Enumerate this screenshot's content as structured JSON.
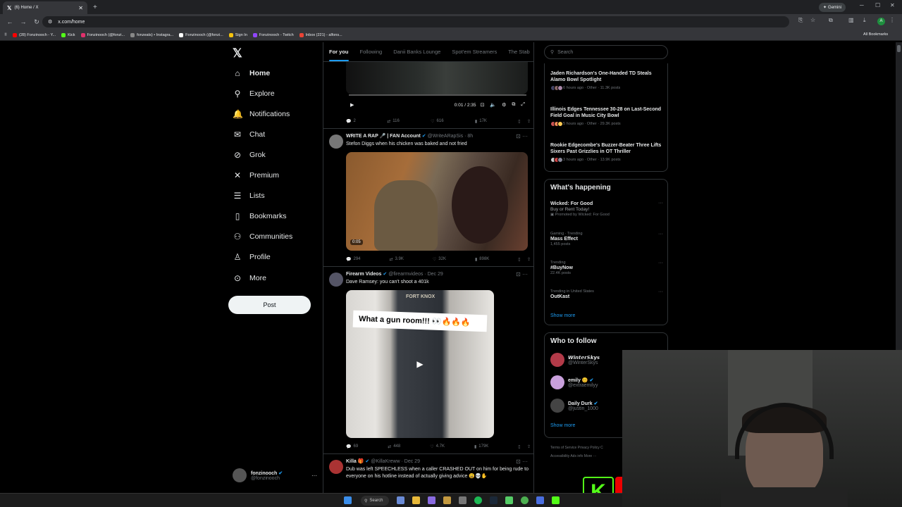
{
  "browser": {
    "tab_title": "(6) Home / X",
    "url": "x.com/home",
    "gemini_label": "Gemini",
    "bookmarks": [
      {
        "label": "(28) Fonzinooch - Y...",
        "color": "#ff0000"
      },
      {
        "label": "Kick",
        "color": "#53fc18"
      },
      {
        "label": "Fonzinooch (@fonzi...",
        "color": "#e1306c"
      },
      {
        "label": "fonzeats) • Instagra...",
        "color": "#888888"
      },
      {
        "label": "Fonzinooch (@fonzi...",
        "color": "#ffffff"
      },
      {
        "label": "Sign In",
        "color": "#f4c20d"
      },
      {
        "label": "Fonzinooch - Twitch",
        "color": "#9146ff"
      },
      {
        "label": "Inbox (221) - alfons...",
        "color": "#ea4335"
      }
    ],
    "all_bookmarks": "All Bookmarks"
  },
  "nav": {
    "items": [
      {
        "label": "Home",
        "icon": "home-icon",
        "glyph": "⌂"
      },
      {
        "label": "Explore",
        "icon": "search-icon",
        "glyph": "⚲"
      },
      {
        "label": "Notifications",
        "icon": "bell-icon",
        "glyph": "🔔"
      },
      {
        "label": "Chat",
        "icon": "mail-icon",
        "glyph": "✉"
      },
      {
        "label": "Grok",
        "icon": "grok-icon",
        "glyph": "⊘"
      },
      {
        "label": "Premium",
        "icon": "x-icon",
        "glyph": "✕"
      },
      {
        "label": "Lists",
        "icon": "list-icon",
        "glyph": "☰"
      },
      {
        "label": "Bookmarks",
        "icon": "bookmark-icon",
        "glyph": "▯"
      },
      {
        "label": "Communities",
        "icon": "people-icon",
        "glyph": "⚇"
      },
      {
        "label": "Profile",
        "icon": "person-icon",
        "glyph": "♙"
      },
      {
        "label": "More",
        "icon": "more-icon",
        "glyph": "⊙"
      }
    ],
    "post_label": "Post",
    "profile_name": "fonzinooch",
    "profile_handle": "@fonzinooch"
  },
  "feed": {
    "tabs": [
      "For you",
      "Following",
      "Danii Banks Lounge",
      "Spot'em Streamers",
      "The Stab"
    ],
    "post0": {
      "time": "0:01 / 2:35",
      "replies": "2",
      "reposts": "116",
      "likes": "616",
      "views": "17K"
    },
    "post1": {
      "name": "WRITE A RAP 🎤 | FAN Account",
      "handle": "@WriteARapSis · 8h",
      "text": "Stefon Diggs when his chicken was baked and not fried",
      "duration": "0:05",
      "replies": "294",
      "reposts": "3.9K",
      "likes": "32K",
      "views": "898K"
    },
    "post2": {
      "name": "Firearm Videos",
      "handle": "@firearmvideos · Dec 29",
      "text": "Dave Ramsey: you can't shoot a 401k",
      "caption": "What a gun room!!! 👀🔥🔥🔥",
      "sign": "FORT KNOX",
      "replies": "69",
      "reposts": "448",
      "likes": "4.7K",
      "views": "179K"
    },
    "post3": {
      "name": "Killa 🎁",
      "handle": "@KillaKreww · Dec 29",
      "text": "Dub was left SPEECHLESS when a caller CRASHED OUT on him for being rude to everyone on his hotline instead of actually giving advice 😩💀✋"
    }
  },
  "right": {
    "search_placeholder": "Search",
    "news": [
      {
        "title": "Jaden Richardson's One-Handed TD Steals Alamo Bowl Spotlight",
        "meta": "6 hours ago · Other · 11.3K posts"
      },
      {
        "title": "Illinois Edges Tennessee 30-28 on Last-Second Field Goal in Music City Bowl",
        "meta": "5 hours ago · Other · 29.3K posts"
      },
      {
        "title": "Rookie Edgecombe's Buzzer-Beater Three Lifts Sixers Past Grizzlies in OT Thriller",
        "meta": "3 hours ago · Other · 13.9K posts"
      }
    ],
    "happening_title": "What's happening",
    "trends": [
      {
        "context": "",
        "title": "Wicked: For Good",
        "sub": "Buy or Rent Today!",
        "extra": "Promoted by Wicked: For Good"
      },
      {
        "context": "Gaming · Trending",
        "title": "Mass Effect",
        "sub": "1,455 posts",
        "extra": ""
      },
      {
        "context": "Trending",
        "title": "#BuyNow",
        "sub": "22.4K posts",
        "extra": ""
      },
      {
        "context": "Trending in United States",
        "title": "OutKast",
        "sub": "",
        "extra": ""
      }
    ],
    "show_more": "Show more",
    "follow_title": "Who to follow",
    "follows": [
      {
        "name": "𝙒𝙞𝙣𝙩𝙚𝙧𝙎𝙠𝙮𝙨",
        "handle": "@WinterSkys",
        "color": "#b23a48"
      },
      {
        "name": "emily 😊",
        "handle": "@extraemilyy",
        "color": "#c9a0dc"
      },
      {
        "name": "Daily Durk",
        "handle": "@justin_1000",
        "color": "#444444"
      }
    ],
    "footer1": "Terms of Service   Privacy Policy   C",
    "footer2": "Accessibility   Ads info   More ···"
  },
  "taskbar": {
    "search_label": "Search"
  },
  "overlay": {
    "kick_letter": "K"
  }
}
